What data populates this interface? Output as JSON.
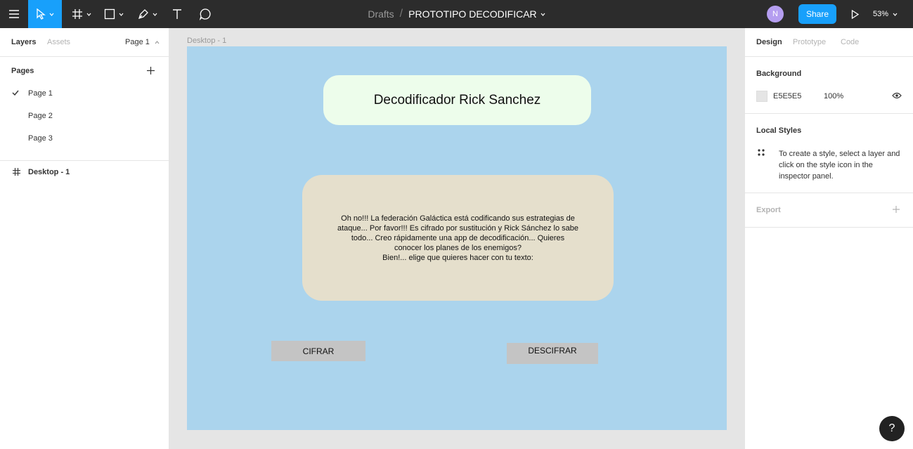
{
  "topbar": {
    "breadcrumb": "Drafts",
    "separator": "/",
    "file_name": "PROTOTIPO DECODIFICAR",
    "avatar_initial": "N",
    "share_label": "Share",
    "zoom": "53%"
  },
  "left_panel": {
    "tabs": {
      "layers": "Layers",
      "assets": "Assets",
      "page_selector": "Page 1"
    },
    "pages_header": "Pages",
    "pages": [
      {
        "label": "Page 1",
        "selected": true
      },
      {
        "label": "Page 2",
        "selected": false
      },
      {
        "label": "Page 3",
        "selected": false
      }
    ],
    "layers": [
      {
        "label": "Desktop - 1"
      }
    ]
  },
  "canvas": {
    "frame_label": "Desktop - 1",
    "frame_color": "#abd4ed",
    "title": "Decodificador Rick Sanchez",
    "message_lines": [
      "Oh no!!! La federación Galáctica está codificando sus estrategias de",
      "ataque... Por favor!!! Es cifrado por sustitución y Rick Sánchez lo sabe",
      "todo... Creo rápidamente una app de decodificación... Quieres",
      "conocer los planes de los enemigos?",
      "Bien!... elige que quieres hacer con tu texto:"
    ],
    "cifrar_label": "CIFRAR",
    "descifrar_label": "DESCIFRAR"
  },
  "right_panel": {
    "tabs": {
      "design": "Design",
      "prototype": "Prototype",
      "code": "Code"
    },
    "background_header": "Background",
    "background_hex": "E5E5E5",
    "background_opacity": "100%",
    "local_styles_header": "Local Styles",
    "local_styles_hint": "To create a style, select a layer and click on the style icon in the inspector panel.",
    "export_header": "Export"
  },
  "help_label": "?",
  "colors": {
    "accent": "#18a0fb",
    "toolbar": "#2c2c2c",
    "avatar": "#b59ef0"
  }
}
